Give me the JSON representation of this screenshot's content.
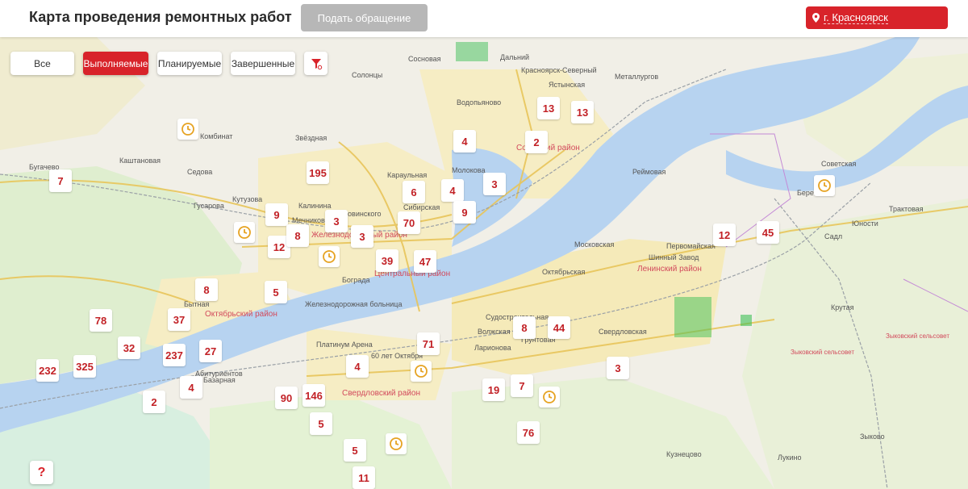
{
  "header": {
    "title": "Карта проведения ремонтных работ",
    "submit_label": "Подать обращение",
    "city_label": "г. Красноярск"
  },
  "filters": [
    {
      "label": "Все",
      "active": false
    },
    {
      "label": "Выполняемые",
      "active": true
    },
    {
      "label": "Планируемые",
      "active": false
    },
    {
      "label": "Завершенные",
      "active": false
    }
  ],
  "markers": [
    "13",
    "13",
    "4",
    "2",
    "195",
    "7",
    "6",
    "4",
    "3",
    "9",
    "9",
    "3",
    "70",
    "3",
    "12",
    "8",
    "39",
    "47",
    "5",
    "8",
    "12",
    "45",
    "78",
    "37",
    "8",
    "44",
    "32",
    "237",
    "27",
    "71",
    "232",
    "325",
    "4",
    "3",
    "7",
    "19",
    "2",
    "4",
    "90",
    "146",
    "5",
    "76",
    "5",
    "11"
  ],
  "map_labels": {
    "districts": [
      "Октябрьский район",
      "Ленинский район",
      "Свердловский район",
      "Советский район",
      "Центральный район",
      "Железнодорожный район"
    ],
    "councils": [
      "Зыковский сельсовет",
      "Зыковский сельсовет"
    ],
    "places": [
      "Бугачево",
      "Седова",
      "Гусарова",
      "Солонцы",
      "Водопьяново",
      "Металлургов",
      "Дальний",
      "Реймовая",
      "Советская",
      "Береть",
      "Садл",
      "Трактовая",
      "Юности",
      "Московская",
      "Октябрьская",
      "Шинный Завод",
      "Первомайская",
      "Судостроительная",
      "Волжская",
      "Свердловская",
      "Кузнецово",
      "Лукино",
      "Зыково",
      "Платинум Арена",
      "Железнодорожная больница",
      "Калинина",
      "Мечникова",
      "Дубровинского",
      "Бограда",
      "Кутузова",
      "Каштановая",
      "Комбинат",
      "Звёздная",
      "Караульная",
      "Сибирская",
      "Молокова",
      "Красноярск-Северный",
      "Ястынская",
      "Бытная",
      "60 лет Октября",
      "Грунтовая",
      "Ларионова",
      "Абитуриентов",
      "Крутая",
      "Сосновая",
      "Базарная"
    ]
  },
  "help_label": "?",
  "colors": {
    "accent": "#d8232a",
    "marker_text": "#c22126",
    "inactive_button": "#b7b7b7"
  }
}
